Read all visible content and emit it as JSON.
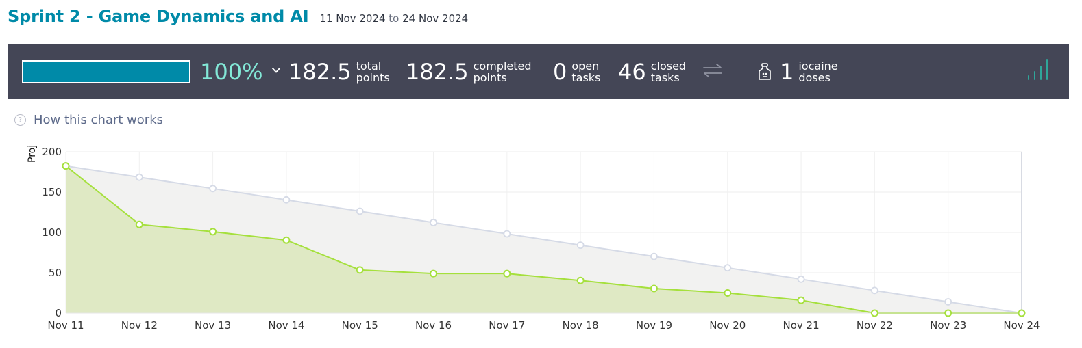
{
  "sprint": {
    "title": "Sprint 2 - Game Dynamics and AI",
    "start_date": "11 Nov 2024",
    "to": "to",
    "end_date": "24 Nov 2024"
  },
  "stats": {
    "progress_fraction": 1.0,
    "percent_label": "100%",
    "total_points": "182.5",
    "total_label_1": "total",
    "total_label_2": "points",
    "completed_points": "182.5",
    "completed_label_1": "completed",
    "completed_label_2": "points",
    "open_tasks": "0",
    "open_label_1": "open",
    "open_label_2": "tasks",
    "closed_tasks": "46",
    "closed_label_1": "closed",
    "closed_label_2": "tasks",
    "iocaine_doses": "1",
    "iocaine_label_1": "iocaine",
    "iocaine_label_2": "doses"
  },
  "help": {
    "how_chart_works": "How this chart works"
  },
  "colors": {
    "accent": "#008aa8",
    "percent": "#83e8d7",
    "bar_bg": "#444656",
    "actual_line": "#a5e03c",
    "actual_fill": "#dfe9c4",
    "ideal_line": "#d5dae6",
    "ideal_fill": "#f2f2f1",
    "bars_icon": "#2fa69a"
  },
  "chart_data": {
    "type": "area",
    "ylabel": "Proj",
    "categories": [
      "Nov 11",
      "Nov 12",
      "Nov 13",
      "Nov 14",
      "Nov 15",
      "Nov 16",
      "Nov 17",
      "Nov 18",
      "Nov 19",
      "Nov 20",
      "Nov 21",
      "Nov 22",
      "Nov 23",
      "Nov 24"
    ],
    "yticks": [
      0,
      50,
      100,
      150,
      200
    ],
    "ylim": [
      0,
      200
    ],
    "grid": true,
    "legend": "none",
    "series": [
      {
        "values": [
          182.5,
          168.5,
          154.4,
          140.4,
          126.3,
          112.3,
          98.3,
          84.2,
          70.2,
          56.2,
          42.1,
          28.1,
          14.0,
          0
        ]
      },
      {
        "values": [
          182.5,
          110,
          101,
          90.5,
          53.5,
          49,
          49,
          40.5,
          30.5,
          25,
          16,
          0,
          0,
          0
        ]
      }
    ]
  }
}
